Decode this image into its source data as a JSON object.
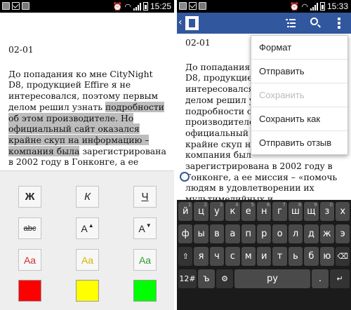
{
  "left_screen": {
    "status": {
      "time": "15:25"
    },
    "document": {
      "heading": "02-01",
      "paragraph": {
        "before": "До попадания ко мне CityNight D8, продукцией Effire я не интересовался, поэтому первым делом решил узнать ",
        "selected": "подробности об этом производителе. Но официальный сайт оказался крайне скуп на информацию – компания была",
        "after": " зарегистрирована в 2002 году в Гонконге, а ее миссия – «помочь"
      }
    },
    "format_panel": {
      "row1": [
        "Ж",
        "К",
        "Ч"
      ],
      "row2": [
        {
          "label": "abc",
          "arrow": ""
        },
        {
          "label": "A",
          "arrow": "▲"
        },
        {
          "label": "A",
          "arrow": "▼"
        }
      ],
      "row3": [
        {
          "label": "Aa",
          "color": "#d32f2f"
        },
        {
          "label": "Aa",
          "color": "#d4b800"
        },
        {
          "label": "Aa",
          "color": "#2e9c2e"
        }
      ],
      "swatches": [
        "#ff0000",
        "#ffff00",
        "#00ff00"
      ]
    }
  },
  "right_screen": {
    "status": {
      "time": "15:33"
    },
    "appbar": {
      "back": "‹"
    },
    "document": {
      "heading": "02-01",
      "fragments": [
        "До попадания ко мне",
        "D8, продукцией",
        "интересовался,",
        "делом решил у",
        "подробности о",
        "производителе",
        "официальный",
        "крайне скуп н",
        "компания был"
      ],
      "continuation": "зарегистрирована в 2002 году в Гонконге, а ее миссия – «помочь людям в удовлетворении их мультимедийных и"
    },
    "menu": {
      "items": [
        {
          "label": "Формат",
          "enabled": true
        },
        {
          "label": "Отправить",
          "enabled": true
        },
        {
          "label": "Сохранить",
          "enabled": false
        },
        {
          "label": "Сохранить как",
          "enabled": true
        },
        {
          "label": "Отправить отзыв",
          "enabled": true
        }
      ]
    },
    "keyboard": {
      "row1": [
        "й",
        "ц",
        "у",
        "к",
        "е",
        "н",
        "г",
        "ш",
        "щ",
        "з",
        "х"
      ],
      "row1_hints": [
        "1",
        "2",
        "3",
        "4",
        "5",
        "6",
        "7",
        "8",
        "9",
        "0",
        ""
      ],
      "row2": [
        "ф",
        "ы",
        "в",
        "а",
        "п",
        "р",
        "о",
        "л",
        "д",
        "ж",
        "э"
      ],
      "row3": [
        "⇧",
        "я",
        "ч",
        "с",
        "м",
        "и",
        "т",
        "ь",
        "б",
        "ю",
        "⌫"
      ],
      "row4": [
        "12#",
        "ъ",
        "⚙",
        "ру",
        ".",
        "↵"
      ]
    }
  },
  "colors": {
    "appbar": "#31579f",
    "selection": "#bdbdbd"
  }
}
